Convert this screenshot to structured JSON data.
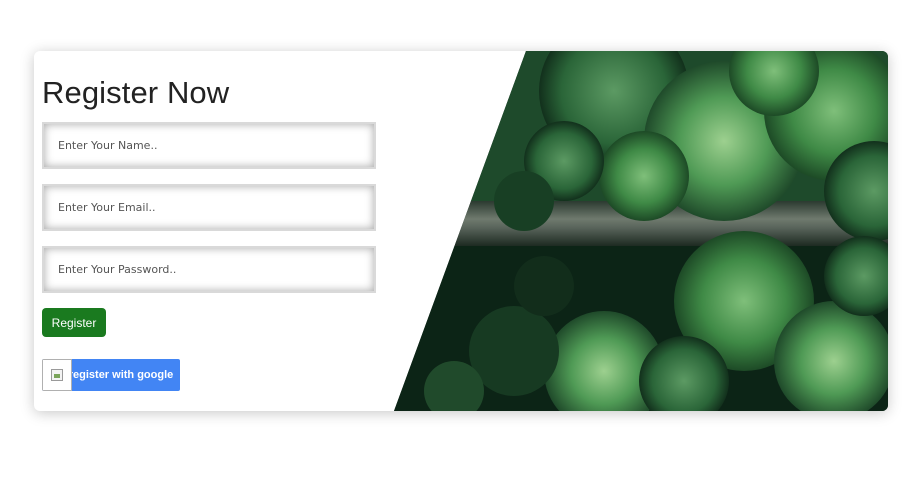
{
  "form": {
    "title": "Register Now",
    "name_placeholder": "Enter Your Name..",
    "email_placeholder": "Enter Your Email..",
    "password_placeholder": "Enter Your Password..",
    "register_label": "Register",
    "google_label": "register with google"
  },
  "colors": {
    "register_button": "#1a7a1f",
    "google_button": "#4285f4"
  },
  "image": {
    "subject": "aerial view of forest with a dirt road"
  }
}
